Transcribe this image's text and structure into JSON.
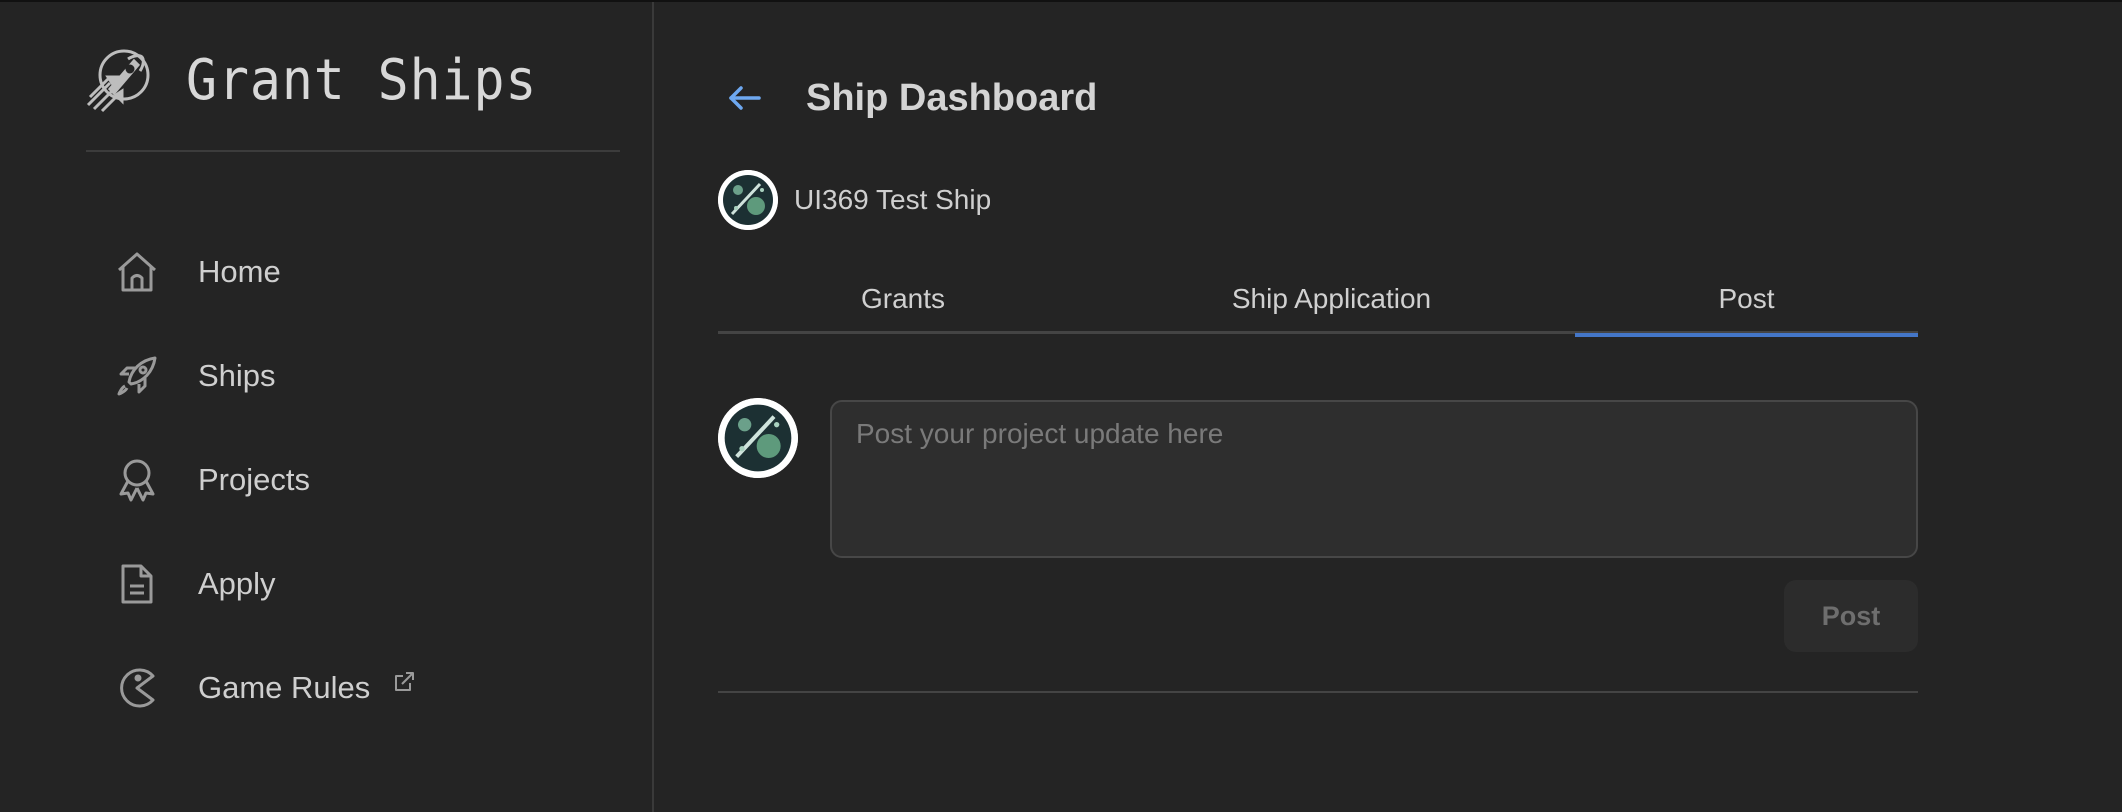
{
  "colors": {
    "background": "#242424",
    "accent": "#4476c7",
    "back_arrow": "#6ea8f0",
    "text": "#cfcfcf",
    "muted": "#7a7a7a"
  },
  "sidebar": {
    "brand": {
      "name": "Grant Ships",
      "icon": "rocket-logo-icon"
    },
    "items": [
      {
        "label": "Home",
        "icon": "home-icon"
      },
      {
        "label": "Ships",
        "icon": "rocket-icon"
      },
      {
        "label": "Projects",
        "icon": "award-icon"
      },
      {
        "label": "Apply",
        "icon": "file-text-icon"
      },
      {
        "label": "Game Rules",
        "icon": "pacman-icon",
        "external": true
      }
    ]
  },
  "main": {
    "title": "Ship Dashboard",
    "ship": {
      "name": "UI369 Test Ship"
    },
    "tabs": [
      {
        "label": "Grants",
        "active": false
      },
      {
        "label": "Ship Application",
        "active": false
      },
      {
        "label": "Post",
        "active": true
      }
    ],
    "composer": {
      "placeholder": "Post your project update here",
      "value": "",
      "submit_label": "Post"
    }
  }
}
